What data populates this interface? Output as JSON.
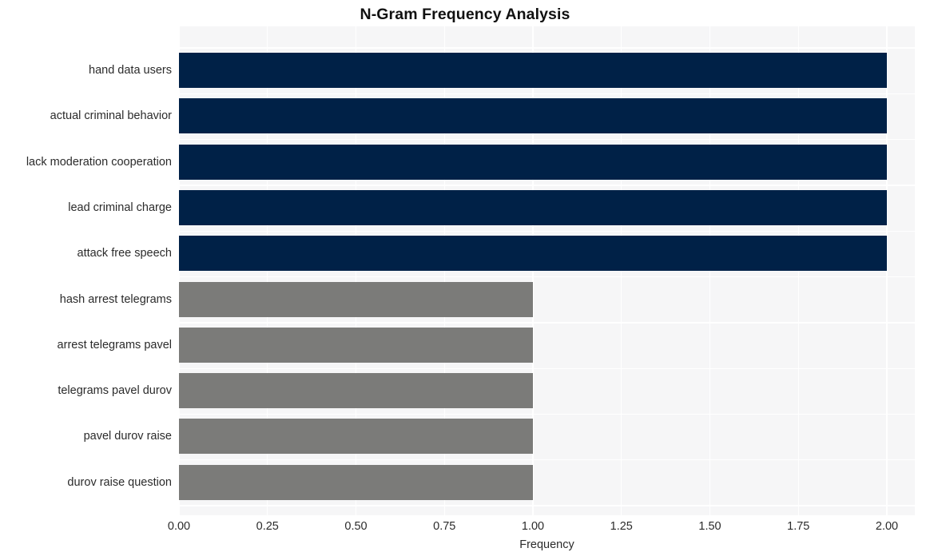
{
  "chart_data": {
    "type": "bar",
    "orientation": "horizontal",
    "title": "N-Gram Frequency Analysis",
    "xlabel": "Frequency",
    "ylabel": "",
    "xlim": [
      0.0,
      2.0
    ],
    "xticks": [
      "0.00",
      "0.25",
      "0.50",
      "0.75",
      "1.00",
      "1.25",
      "1.50",
      "1.75",
      "2.00"
    ],
    "xtick_values": [
      0.0,
      0.25,
      0.5,
      0.75,
      1.0,
      1.25,
      1.5,
      1.75,
      2.0
    ],
    "grid": true,
    "grid_color": "#ffffff",
    "legend": "none",
    "plot_background": "#f6f6f7",
    "figure_background": "#ffffff",
    "categories": [
      "hand data users",
      "actual criminal behavior",
      "lack moderation cooperation",
      "lead criminal charge",
      "attack free speech",
      "hash arrest telegrams",
      "arrest telegrams pavel",
      "telegrams pavel durov",
      "pavel durov raise",
      "durov raise question"
    ],
    "values": [
      2,
      2,
      2,
      2,
      2,
      1,
      1,
      1,
      1,
      1
    ],
    "bar_colors": [
      "#002147",
      "#002147",
      "#002147",
      "#002147",
      "#002147",
      "#7b7b79",
      "#7b7b79",
      "#7b7b79",
      "#7b7b79",
      "#7b7b79"
    ],
    "colors": {
      "primary": "#002147",
      "secondary": "#7b7b79",
      "text": "#2b2b2b",
      "title": "#111111"
    }
  }
}
